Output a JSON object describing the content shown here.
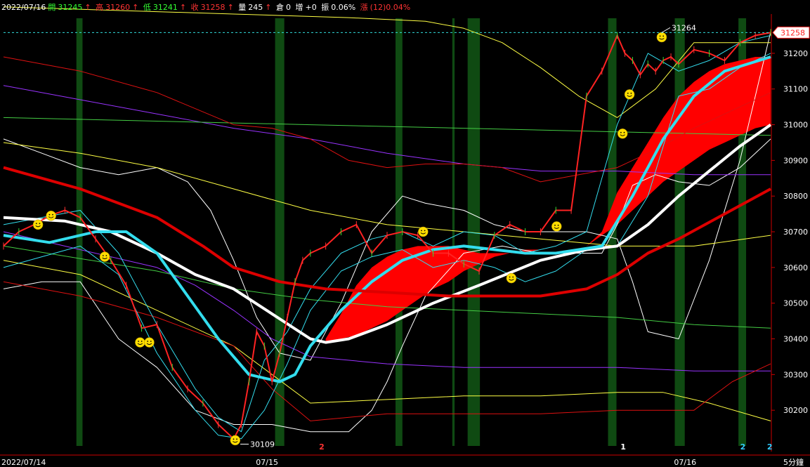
{
  "header": {
    "date": "2022/07/16",
    "open_label": "開",
    "open": "31245",
    "high_label": "高",
    "high": "31260",
    "low_label": "低",
    "low": "31241",
    "close_label": "收",
    "close": "31258",
    "vol_label": "量",
    "vol": "245",
    "pos_label": "倉",
    "pos": "0",
    "inc_label": "增",
    "inc": "+0",
    "amp_label": "振",
    "amp": "0.06%",
    "chg_label": "漲",
    "chg": "(12)0.04%",
    "up_arrow": "↑"
  },
  "chart_data": {
    "type": "line",
    "title": "",
    "timeframe_label": "5分鐘",
    "ylim": [
      30100,
      31310
    ],
    "y_ticks": [
      30200,
      30300,
      30400,
      30500,
      30600,
      30700,
      30800,
      30900,
      31000,
      31100,
      31200
    ],
    "x_labels": [
      {
        "label": "2022/07/14",
        "pos": 0.0
      },
      {
        "label": "07/15",
        "pos": 0.34
      },
      {
        "label": "07/16",
        "pos": 0.885
      }
    ],
    "last_price": 31258,
    "high_annotation": {
      "value": 31264,
      "label": "31264"
    },
    "low_annotation": {
      "value": 30109,
      "label": "30109"
    },
    "bottom_markers": [
      {
        "label": "2",
        "pos": 0.414,
        "color": "#ff3333"
      },
      {
        "label": "1",
        "pos": 0.807,
        "color": "#ffffff"
      },
      {
        "label": "2",
        "pos": 0.963,
        "color": "#33ccff"
      },
      {
        "label": "2",
        "pos": 0.998,
        "color": "#33ccff"
      }
    ],
    "green_bands": [
      {
        "start": 0.095,
        "end": 0.103
      },
      {
        "start": 0.354,
        "end": 0.366
      },
      {
        "start": 0.511,
        "end": 0.52
      },
      {
        "start": 0.585,
        "end": 0.588
      },
      {
        "start": 0.605,
        "end": 0.621
      },
      {
        "start": 0.788,
        "end": 0.799
      },
      {
        "start": 0.875,
        "end": 0.888
      },
      {
        "start": 0.958,
        "end": 0.968
      }
    ],
    "price": {
      "x": [
        0,
        0.02,
        0.04,
        0.06,
        0.08,
        0.1,
        0.12,
        0.14,
        0.16,
        0.18,
        0.2,
        0.22,
        0.24,
        0.26,
        0.28,
        0.3,
        0.31,
        0.32,
        0.33,
        0.34,
        0.35,
        0.36,
        0.37,
        0.38,
        0.39,
        0.4,
        0.42,
        0.44,
        0.46,
        0.48,
        0.5,
        0.52,
        0.54,
        0.56,
        0.58,
        0.6,
        0.62,
        0.64,
        0.66,
        0.68,
        0.7,
        0.72,
        0.74,
        0.76,
        0.78,
        0.8,
        0.81,
        0.82,
        0.83,
        0.84,
        0.85,
        0.86,
        0.87,
        0.88,
        0.9,
        0.92,
        0.94,
        0.96,
        0.98,
        1.0
      ],
      "y": [
        30660,
        30700,
        30720,
        30745,
        30760,
        30740,
        30680,
        30620,
        30550,
        30430,
        30440,
        30320,
        30260,
        30220,
        30160,
        30120,
        30160,
        30280,
        30420,
        30380,
        30280,
        30360,
        30460,
        30560,
        30620,
        30640,
        30660,
        30700,
        30720,
        30640,
        30690,
        30700,
        30690,
        30640,
        30640,
        30610,
        30590,
        30690,
        30720,
        30700,
        30700,
        30760,
        30760,
        31080,
        31150,
        31250,
        31200,
        31180,
        31140,
        31170,
        31150,
        31180,
        31190,
        31170,
        31210,
        31200,
        31180,
        31230,
        31250,
        31258
      ]
    },
    "smileys": [
      {
        "x": 0.045,
        "y": 30720
      },
      {
        "x": 0.062,
        "y": 30745
      },
      {
        "x": 0.132,
        "y": 30630
      },
      {
        "x": 0.178,
        "y": 30390
      },
      {
        "x": 0.19,
        "y": 30390
      },
      {
        "x": 0.302,
        "y": 30116
      },
      {
        "x": 0.547,
        "y": 30700
      },
      {
        "x": 0.662,
        "y": 30570
      },
      {
        "x": 0.721,
        "y": 30715
      },
      {
        "x": 0.807,
        "y": 30975
      },
      {
        "x": 0.816,
        "y": 31085
      },
      {
        "x": 0.858,
        "y": 31245
      }
    ],
    "series": [
      {
        "color": "#ffffff",
        "width": 4,
        "x": [
          0,
          0.08,
          0.14,
          0.2,
          0.25,
          0.3,
          0.35,
          0.4,
          0.42,
          0.45,
          0.5,
          0.56,
          0.62,
          0.7,
          0.76,
          0.8,
          0.84,
          0.88,
          0.92,
          0.96,
          1.0
        ],
        "y": [
          30740,
          30730,
          30700,
          30640,
          30580,
          30540,
          30470,
          30400,
          30390,
          30400,
          30440,
          30500,
          30550,
          30620,
          30650,
          30660,
          30720,
          30800,
          30870,
          30940,
          31000
        ]
      },
      {
        "color": "#33ddee",
        "width": 4,
        "x": [
          0,
          0.06,
          0.12,
          0.16,
          0.2,
          0.24,
          0.28,
          0.32,
          0.36,
          0.38,
          0.4,
          0.44,
          0.48,
          0.52,
          0.56,
          0.6,
          0.64,
          0.68,
          0.72,
          0.78,
          0.82,
          0.86,
          0.9,
          0.94,
          1.0
        ],
        "y": [
          30690,
          30670,
          30700,
          30700,
          30640,
          30520,
          30400,
          30300,
          30280,
          30300,
          30380,
          30480,
          30560,
          30620,
          30650,
          30660,
          30650,
          30640,
          30640,
          30660,
          30800,
          30960,
          31080,
          31150,
          31190
        ]
      },
      {
        "color": "#dd0000",
        "width": 4,
        "x": [
          0,
          0.1,
          0.2,
          0.26,
          0.3,
          0.36,
          0.42,
          0.5,
          0.58,
          0.64,
          0.7,
          0.76,
          0.8,
          0.84,
          0.88,
          0.94,
          1.0
        ],
        "y": [
          30880,
          30820,
          30740,
          30660,
          30600,
          30560,
          30540,
          30530,
          30520,
          30520,
          30520,
          30540,
          30580,
          30640,
          30680,
          30750,
          30820
        ]
      },
      {
        "color": "#ffffff",
        "width": 1,
        "x": [
          0,
          0.05,
          0.1,
          0.15,
          0.2,
          0.24,
          0.27,
          0.3,
          0.33,
          0.36,
          0.4,
          0.44,
          0.48,
          0.52,
          0.55,
          0.6,
          0.64,
          0.68,
          0.72,
          0.76,
          0.8,
          0.82,
          0.84,
          0.88,
          0.92,
          0.96,
          1.0
        ],
        "y": [
          30960,
          30920,
          30880,
          30860,
          30880,
          30840,
          30760,
          30620,
          30460,
          30360,
          30340,
          30500,
          30700,
          30800,
          30780,
          30760,
          30720,
          30700,
          30700,
          30700,
          30680,
          30560,
          30420,
          30400,
          30620,
          30900,
          31260
        ]
      },
      {
        "color": "#ffffff",
        "width": 1,
        "x": [
          0,
          0.05,
          0.1,
          0.15,
          0.2,
          0.25,
          0.3,
          0.35,
          0.4,
          0.45,
          0.48,
          0.5,
          0.52,
          0.55,
          0.6,
          0.65,
          0.7,
          0.75,
          0.78,
          0.8,
          0.82,
          0.85,
          0.88,
          0.92,
          0.96,
          1.0
        ],
        "y": [
          30540,
          30560,
          30560,
          30400,
          30320,
          30200,
          30160,
          30160,
          30140,
          30140,
          30200,
          30280,
          30380,
          30520,
          30640,
          30660,
          30640,
          30640,
          30640,
          30720,
          30830,
          30860,
          30840,
          30830,
          30880,
          30960
        ]
      },
      {
        "color": "#ffff44",
        "width": 1,
        "x": [
          0,
          0.1,
          0.2,
          0.3,
          0.4,
          0.5,
          0.6,
          0.7,
          0.8,
          0.9,
          1.0
        ],
        "y": [
          30950,
          30920,
          30880,
          30820,
          30760,
          30720,
          30700,
          30680,
          30660,
          30660,
          30690
        ]
      },
      {
        "color": "#ffff44",
        "width": 1,
        "x": [
          0,
          0.1,
          0.2,
          0.3,
          0.35,
          0.4,
          0.5,
          0.6,
          0.7,
          0.8,
          0.86,
          0.92,
          1.0
        ],
        "y": [
          30620,
          30580,
          30480,
          30380,
          30300,
          30220,
          30230,
          30240,
          30240,
          30250,
          30250,
          30220,
          30170
        ]
      },
      {
        "color": "#ffff44",
        "width": 1,
        "x": [
          0,
          0.3,
          0.45,
          0.55,
          0.6,
          0.65,
          0.7,
          0.75,
          0.8,
          0.85,
          0.9,
          1.0
        ],
        "y": [
          31330,
          31310,
          31300,
          31290,
          31270,
          31230,
          31160,
          31080,
          31020,
          31100,
          31230,
          31230
        ]
      },
      {
        "color": "#9933ff",
        "width": 1,
        "x": [
          0,
          0.1,
          0.2,
          0.3,
          0.4,
          0.5,
          0.6,
          0.7,
          0.8,
          0.9,
          1.0
        ],
        "y": [
          31110,
          31070,
          31030,
          30990,
          30960,
          30920,
          30890,
          30870,
          30870,
          30860,
          30860
        ]
      },
      {
        "color": "#9933ff",
        "width": 1,
        "x": [
          0,
          0.1,
          0.2,
          0.25,
          0.3,
          0.35,
          0.4,
          0.5,
          0.6,
          0.7,
          0.8,
          0.9,
          1.0
        ],
        "y": [
          30700,
          30650,
          30600,
          30550,
          30480,
          30400,
          30350,
          30330,
          30320,
          30320,
          30320,
          30310,
          30310
        ]
      },
      {
        "color": "#44cc44",
        "width": 1,
        "x": [
          0,
          0.2,
          0.4,
          0.6,
          0.8,
          1.0
        ],
        "y": [
          31020,
          31010,
          31000,
          30990,
          30980,
          30970
        ]
      },
      {
        "color": "#44cc44",
        "width": 1,
        "x": [
          0,
          0.2,
          0.3,
          0.4,
          0.5,
          0.6,
          0.7,
          0.8,
          0.9,
          1.0
        ],
        "y": [
          30660,
          30590,
          30540,
          30510,
          30490,
          30480,
          30470,
          30460,
          30440,
          30430
        ]
      },
      {
        "color": "#dd1111",
        "width": 1,
        "x": [
          0,
          0.1,
          0.2,
          0.3,
          0.35,
          0.4,
          0.45,
          0.5,
          0.55,
          0.6,
          0.65,
          0.7,
          0.75,
          0.8,
          0.85,
          0.9,
          1.0
        ],
        "y": [
          31190,
          31150,
          31090,
          31000,
          30990,
          30960,
          30900,
          30880,
          30890,
          30890,
          30880,
          30840,
          30860,
          30880,
          30930,
          30990,
          31090
        ]
      },
      {
        "color": "#dd1111",
        "width": 1,
        "x": [
          0,
          0.1,
          0.2,
          0.3,
          0.35,
          0.4,
          0.5,
          0.6,
          0.7,
          0.8,
          0.86,
          0.9,
          0.95,
          1.0
        ],
        "y": [
          30560,
          30520,
          30460,
          30380,
          30260,
          30170,
          30190,
          30190,
          30190,
          30200,
          30200,
          30200,
          30280,
          30330
        ]
      },
      {
        "color": "#33ddee",
        "width": 1,
        "x": [
          0,
          0.1,
          0.15,
          0.2,
          0.25,
          0.28,
          0.31,
          0.34,
          0.37,
          0.4,
          0.44,
          0.48,
          0.52,
          0.56,
          0.6,
          0.64,
          0.68,
          0.72,
          0.76,
          0.8,
          0.84,
          0.88,
          0.92,
          0.96,
          1.0
        ],
        "y": [
          30720,
          30760,
          30640,
          30440,
          30260,
          30180,
          30140,
          30340,
          30420,
          30540,
          30640,
          30680,
          30700,
          30660,
          30700,
          30690,
          30640,
          30660,
          30700,
          31000,
          31200,
          31150,
          31180,
          31230,
          31250
        ]
      },
      {
        "color": "#33ddee",
        "width": 1,
        "x": [
          0,
          0.1,
          0.15,
          0.2,
          0.25,
          0.28,
          0.31,
          0.34,
          0.37,
          0.4,
          0.44,
          0.48,
          0.52,
          0.56,
          0.6,
          0.64,
          0.68,
          0.72,
          0.76,
          0.8,
          0.84,
          0.88,
          0.92,
          0.96,
          1.0
        ],
        "y": [
          30600,
          30660,
          30580,
          30360,
          30200,
          30130,
          30120,
          30200,
          30330,
          30480,
          30590,
          30630,
          30650,
          30600,
          30620,
          30600,
          30560,
          30590,
          30650,
          30660,
          30800,
          31080,
          31100,
          31160,
          31200
        ]
      }
    ],
    "ribbon": {
      "x": [
        0.42,
        0.44,
        0.46,
        0.48,
        0.5,
        0.52,
        0.54,
        0.56,
        0.58,
        0.6,
        0.62,
        0.64,
        0.66,
        0.68,
        0.7,
        0.72,
        0.74,
        0.76,
        0.78,
        0.8,
        0.82,
        0.84,
        0.86,
        0.88,
        0.9,
        0.92,
        0.94,
        0.96,
        0.98,
        1.0
      ],
      "upper": [
        30400,
        30470,
        30550,
        30600,
        30630,
        30650,
        30660,
        30660,
        30660,
        30650,
        30640,
        30640,
        30640,
        30640,
        30650,
        30660,
        30660,
        30660,
        30700,
        30810,
        30880,
        30950,
        31020,
        31080,
        31120,
        31150,
        31170,
        31180,
        31190,
        31190
      ],
      "lower": [
        30390,
        30400,
        30410,
        30430,
        30450,
        30480,
        30510,
        30540,
        30560,
        30590,
        30610,
        30630,
        30640,
        30650,
        30650,
        30660,
        30660,
        30660,
        30690,
        30720,
        30760,
        30800,
        30840,
        30870,
        30900,
        30930,
        30950,
        30970,
        30990,
        31000
      ]
    }
  }
}
